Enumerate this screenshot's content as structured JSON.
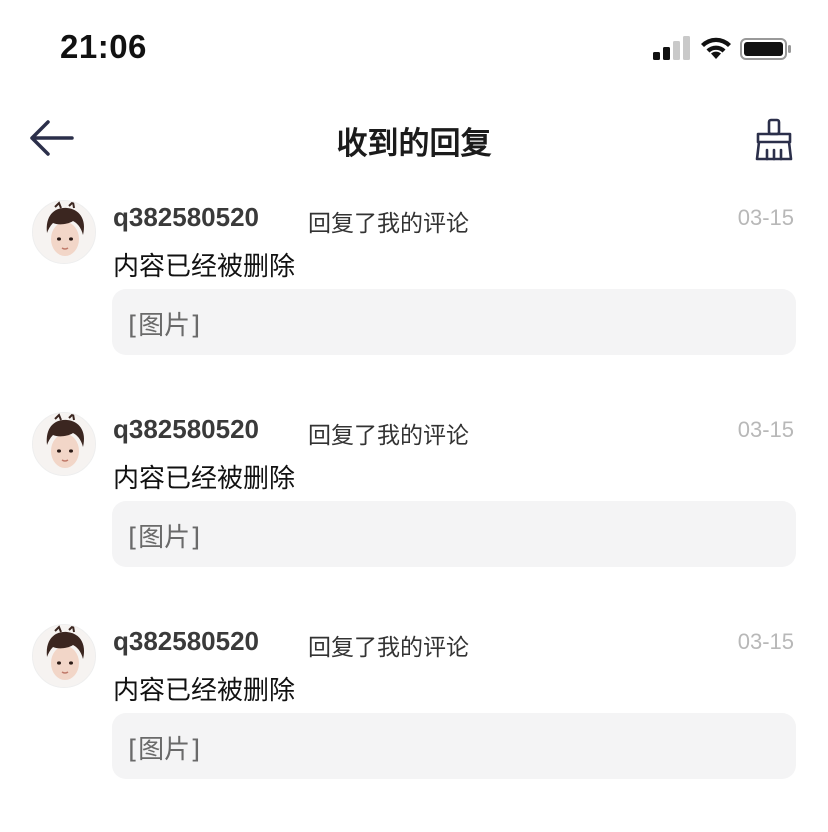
{
  "status_bar": {
    "time": "21:06",
    "icons": [
      "signal-icon",
      "wifi-icon",
      "battery-icon"
    ]
  },
  "nav": {
    "title": "收到的回复",
    "back_icon": "arrow-left-icon",
    "clear_icon": "broom-icon"
  },
  "colors": {
    "background": "#ffffff",
    "quote_background": "#f4f4f5",
    "date_text": "#b8b8b8",
    "nav_icon": "#2b2f4a"
  },
  "replies": [
    {
      "user": "q382580520",
      "action": "回复了我的评论",
      "date": "03-15",
      "content": "内容已经被删除",
      "quote": "[图片]"
    },
    {
      "user": "q382580520",
      "action": "回复了我的评论",
      "date": "03-15",
      "content": "内容已经被删除",
      "quote": "[图片]"
    },
    {
      "user": "q382580520",
      "action": "回复了我的评论",
      "date": "03-15",
      "content": "内容已经被删除",
      "quote": "[图片]"
    }
  ]
}
